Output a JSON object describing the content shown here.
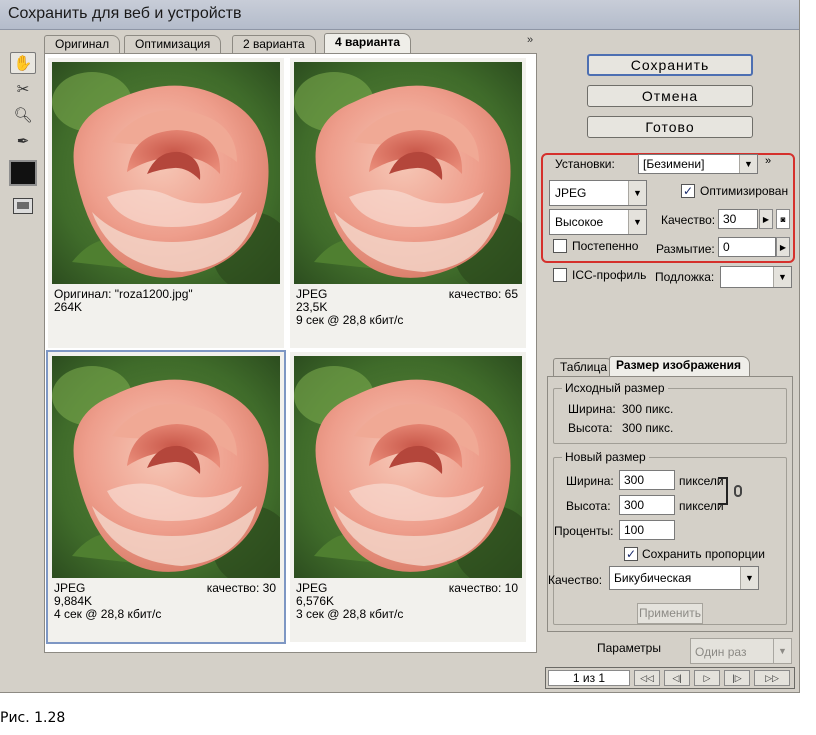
{
  "window": {
    "title": "Сохранить для веб и устройств"
  },
  "tabs": [
    {
      "label": "Оригинал"
    },
    {
      "label": "Оптимизация"
    },
    {
      "label": "2 варианта"
    },
    {
      "label": "4 варианта",
      "active": true
    }
  ],
  "tab_overflow": "»",
  "previews": [
    {
      "line1": "Оригинал: \"roza1200.jpg\"",
      "line2": "264K",
      "line3": "",
      "quality": ""
    },
    {
      "line1": "JPEG",
      "line2": "23,5K",
      "line3": "9 сек @ 28,8 кбит/с",
      "quality": "качество: 65"
    },
    {
      "line1": "JPEG",
      "line2": "9,884K",
      "line3": "4 сек @ 28,8 кбит/с",
      "quality": "качество: 30",
      "selected": true
    },
    {
      "line1": "JPEG",
      "line2": "6,576K",
      "line3": "3 сек @ 28,8 кбит/с",
      "quality": "качество: 10"
    }
  ],
  "buttons": {
    "save": "Сохранить",
    "cancel": "Отмена",
    "done": "Готово"
  },
  "settings": {
    "label": "Установки:",
    "preset": "[Безимени]",
    "overflow": "»",
    "format": "JPEG",
    "quality_preset": "Высокое",
    "optimized_label": "Оптимизирован",
    "optimized_checked": true,
    "quality_label": "Качество:",
    "quality_value": "30",
    "progressive_label": "Постепенно",
    "progressive_checked": false,
    "blur_label": "Размытие:",
    "blur_value": "0",
    "icc_label": "ICC-профиль",
    "icc_checked": false,
    "matte_label": "Подложка:",
    "matte_value": ""
  },
  "info_tabs": [
    {
      "label": "Таблица"
    },
    {
      "label": "Размер изображения",
      "active": true
    }
  ],
  "original_size": {
    "title": "Исходный размер",
    "width_label": "Ширина:",
    "width_value": "300 пикс.",
    "height_label": "Высота:",
    "height_value": "300 пикс."
  },
  "new_size": {
    "title": "Новый размер",
    "width_label": "Ширина:",
    "width_value": "300",
    "width_unit": "пиксели",
    "height_label": "Высота:",
    "height_value": "300",
    "height_unit": "пиксели",
    "percent_label": "Проценты:",
    "percent_value": "100",
    "constrain_label": "Сохранить пропорции",
    "constrain_checked": true,
    "quality_label": "Качество:",
    "quality_value": "Бикубическая"
  },
  "apply_label": "Применить",
  "params": {
    "label": "Параметры",
    "value": "Один раз"
  },
  "pager": {
    "counter": "1 из 1"
  },
  "figure_caption": "Рис. 1.28",
  "colors": {
    "accent": "#4d6fb2",
    "highlight_frame": "#d5302c",
    "selection": "#7e97c4"
  }
}
